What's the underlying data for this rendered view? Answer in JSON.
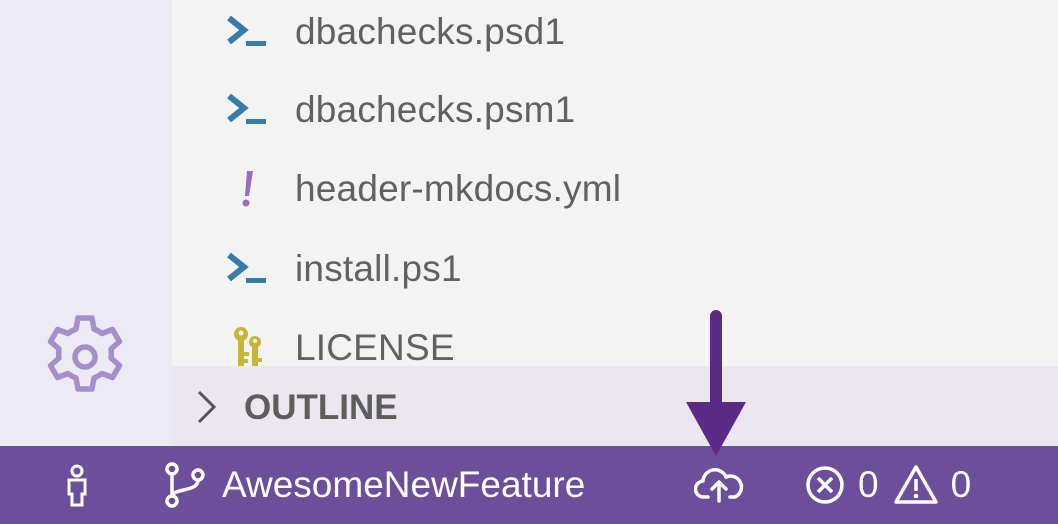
{
  "explorer": {
    "files": [
      {
        "name": "dbachecks.psd1",
        "icon": "powershell-icon"
      },
      {
        "name": "dbachecks.psm1",
        "icon": "powershell-icon"
      },
      {
        "name": "header-mkdocs.yml",
        "icon": "yaml-icon"
      },
      {
        "name": "install.ps1",
        "icon": "powershell-icon"
      },
      {
        "name": "LICENSE",
        "icon": "license-key-icon"
      }
    ]
  },
  "outline": {
    "label": "OUTLINE"
  },
  "status_bar": {
    "branch": "AwesomeNewFeature",
    "errors": "0",
    "warnings": "0"
  },
  "colors": {
    "status_bar": "#6c4f9b",
    "arrow": "#5b2a86",
    "powershell": "#3a7ba6",
    "yaml": "#9a6bc0",
    "license": "#c7b53a",
    "gear": "#a58fcb"
  }
}
